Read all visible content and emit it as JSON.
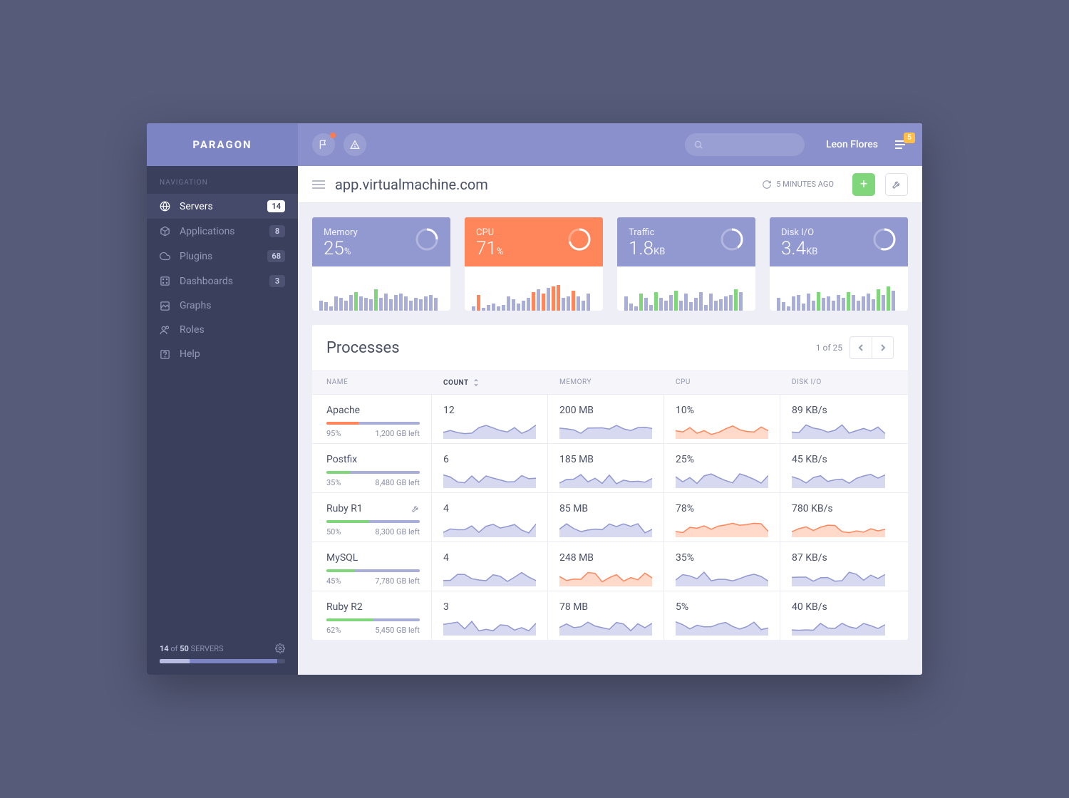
{
  "brand": "PARAGON",
  "nav_label": "NAVIGATION",
  "nav": [
    {
      "icon": "globe",
      "label": "Servers",
      "badge": "14",
      "active": true
    },
    {
      "icon": "cube",
      "label": "Applications",
      "badge": "8"
    },
    {
      "icon": "cloud",
      "label": "Plugins",
      "badge": "68"
    },
    {
      "icon": "grid",
      "label": "Dashboards",
      "badge": "3"
    },
    {
      "icon": "image",
      "label": "Graphs"
    },
    {
      "icon": "users",
      "label": "Roles"
    },
    {
      "icon": "help",
      "label": "Help"
    }
  ],
  "sidebar_footer": {
    "count": "14",
    "of": "of",
    "total": "50",
    "label": "SERVERS"
  },
  "topbar": {
    "user": "Leon Flores",
    "notif_count": "5"
  },
  "subbar": {
    "title": "app.virtualmachine.com",
    "updated": "5 MINUTES AGO"
  },
  "cards": [
    {
      "label": "Memory",
      "value": "25",
      "unit": "%",
      "hot": false,
      "pct": 25
    },
    {
      "label": "CPU",
      "value": "71",
      "unit": "%",
      "hot": true,
      "pct": 71
    },
    {
      "label": "Traffic",
      "value": "1.8",
      "unit": "KB",
      "hot": false,
      "pct": 40
    },
    {
      "label": "Disk I/O",
      "value": "3.4",
      "unit": "KB",
      "hot": false,
      "pct": 55
    }
  ],
  "panel": {
    "title": "Processes",
    "page": "1 of 25",
    "cols": {
      "name": "NAME",
      "count": "COUNT",
      "memory": "MEMORY",
      "cpu": "CPU",
      "disk": "DISK I/O"
    },
    "rows": [
      {
        "name": "Apache",
        "pct": "95%",
        "left": "1,200 GB left",
        "pgreen": 34,
        "count": "12",
        "memory": "200 MB",
        "cpu": "10%",
        "disk": "89 KB/s",
        "cpu_hot": true,
        "name_hot": true
      },
      {
        "name": "Postfix",
        "pct": "35%",
        "left": "8,480 GB left",
        "pgreen": 25,
        "count": "6",
        "memory": "185 MB",
        "cpu": "25%",
        "disk": "45 KB/s"
      },
      {
        "name": "Ruby R1",
        "pct": "50%",
        "left": "8,300 GB left",
        "pgreen": 45,
        "count": "4",
        "memory": "85 MB",
        "cpu": "78%",
        "disk": "780 KB/s",
        "wrench": true,
        "cpu_hot": true,
        "disk_hot": true
      },
      {
        "name": "MySQL",
        "pct": "45%",
        "left": "7,780 GB left",
        "pgreen": 30,
        "count": "4",
        "memory": "248 MB",
        "cpu": "35%",
        "disk": "87 KB/s",
        "mem_hot": true
      },
      {
        "name": "Ruby R2",
        "pct": "62%",
        "left": "5,450 GB left",
        "pgreen": 50,
        "count": "3",
        "memory": "78 MB",
        "cpu": "5%",
        "disk": "40 KB/s"
      }
    ]
  },
  "chart_data": {
    "cards": [
      {
        "type": "bar",
        "title": "Memory",
        "values": [
          14,
          12,
          6,
          20,
          18,
          14,
          22,
          26,
          20,
          18,
          16,
          30,
          18,
          24,
          16,
          22,
          24,
          20,
          14,
          18,
          16,
          20,
          22,
          18
        ],
        "highlight": [
          7,
          11
        ]
      },
      {
        "type": "bar",
        "title": "CPU",
        "values": [
          6,
          22,
          4,
          8,
          10,
          6,
          8,
          20,
          16,
          10,
          14,
          18,
          26,
          30,
          24,
          32,
          34,
          36,
          18,
          20,
          28,
          20,
          14,
          24
        ],
        "highlight": [
          1,
          12,
          14,
          16,
          17,
          20
        ],
        "hot": true
      },
      {
        "type": "bar",
        "title": "Traffic",
        "values": [
          20,
          10,
          6,
          24,
          18,
          8,
          26,
          18,
          14,
          22,
          28,
          14,
          24,
          12,
          18,
          26,
          8,
          24,
          14,
          16,
          20,
          22,
          30,
          26
        ],
        "highlight": [
          3,
          6,
          10,
          22
        ]
      },
      {
        "type": "bar",
        "title": "Disk I/O",
        "values": [
          18,
          12,
          6,
          20,
          22,
          10,
          24,
          14,
          26,
          18,
          20,
          14,
          22,
          18,
          26,
          22,
          14,
          20,
          24,
          16,
          30,
          22,
          34,
          28
        ],
        "highlight": [
          8,
          14,
          20,
          22
        ]
      }
    ]
  }
}
